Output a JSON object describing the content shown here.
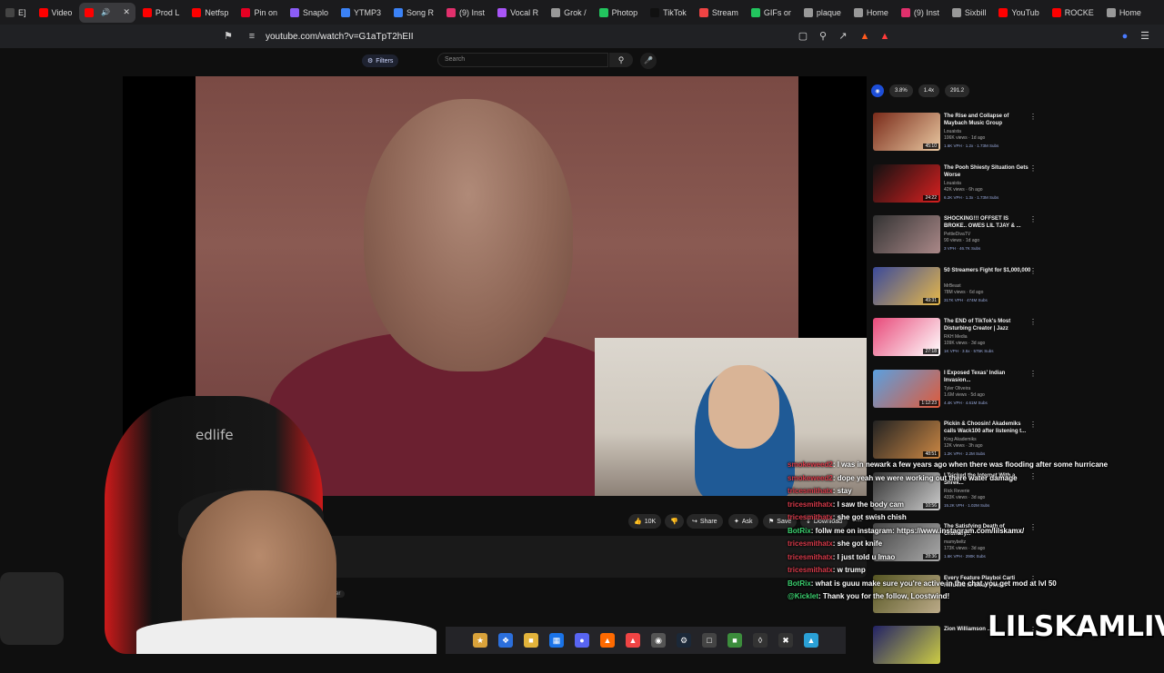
{
  "tabs": [
    {
      "label": "E]",
      "color": "#444"
    },
    {
      "label": "Video",
      "color": "#ff0000"
    },
    {
      "label": "",
      "color": "#ff0000",
      "active": true
    },
    {
      "label": "Prod L",
      "color": "#ff0000"
    },
    {
      "label": "Netfsp",
      "color": "#ff0000"
    },
    {
      "label": "Pin on",
      "color": "#e60023"
    },
    {
      "label": "Snaplo",
      "color": "#8b5cf6"
    },
    {
      "label": "YTMP3",
      "color": "#3b82f6"
    },
    {
      "label": "Song R",
      "color": "#3b82f6"
    },
    {
      "label": "(9) Inst",
      "color": "#e1306c"
    },
    {
      "label": "Vocal R",
      "color": "#a855f7"
    },
    {
      "label": "Grok /",
      "color": "#999"
    },
    {
      "label": "Photop",
      "color": "#22c55e"
    },
    {
      "label": "TikTok",
      "color": "#111"
    },
    {
      "label": "Stream",
      "color": "#ef4444"
    },
    {
      "label": "GIFs or",
      "color": "#22c55e"
    },
    {
      "label": "plaque",
      "color": "#999"
    },
    {
      "label": "Home",
      "color": "#999"
    },
    {
      "label": "(9) Inst",
      "color": "#e1306c"
    },
    {
      "label": "Sixbill",
      "color": "#999"
    },
    {
      "label": "YouTub",
      "color": "#ff0000"
    },
    {
      "label": "ROCKE",
      "color": "#ff0000"
    },
    {
      "label": "Home",
      "color": "#999"
    }
  ],
  "address_bar": {
    "url": "youtube.com/watch?v=G1aTpT2hEII"
  },
  "youtube": {
    "filters_label": "Filters",
    "search_placeholder": "Search",
    "sort_label": "Filter"
  },
  "actions": {
    "like_count": "10K",
    "share_label": "Share",
    "ask_label": "Ask",
    "save_label": "Save",
    "download_label": "Download"
  },
  "sidebar_stats": [
    "3.8%",
    "1.4x",
    "291.2"
  ],
  "recommendations": [
    {
      "title": "The Rise and Collapse of Maybach Music Group",
      "channel": "Louaista",
      "meta": "106K views · 1d ago",
      "badge": "1.6K VPH · 1.2x · 1.73M Subs",
      "duration": "45:10",
      "c1": "#7a2b1a",
      "c2": "#e8c7a0"
    },
    {
      "title": "The Pooh Shiesty Situation Gets Worse",
      "channel": "Louaista",
      "meta": "42K views · 6h ago",
      "badge": "6.2K VPH · 1.3x · 1.73M Subs",
      "duration": "24:22",
      "c1": "#111",
      "c2": "#d92020"
    },
    {
      "title": "SHOCKING!!! OFFSET IS BROKE.. OWES LIL TJAY & ...",
      "channel": "PettieDivaTV",
      "meta": "90 views · 1d ago",
      "badge": "3 VPH · 46.7K Subs",
      "duration": "",
      "c1": "#333",
      "c2": "#a88"
    },
    {
      "title": "50 Streamers Fight for $1,000,000",
      "channel": "MrBeast",
      "meta": "78M views · 6d ago",
      "badge": "317K VPH · 474M Subs",
      "duration": "49:31",
      "c1": "#3b4a9a",
      "c2": "#e6b84a"
    },
    {
      "title": "The END of TikTok's Most Disturbing Creator | Jazz",
      "channel": "RKH Media",
      "meta": "109K views · 3d ago",
      "badge": "1K VPH · 3.5x · 575K Subs",
      "duration": "27:18",
      "c1": "#e84a7a",
      "c2": "#fff"
    },
    {
      "title": "I Exposed Texas' Indian Invasion...",
      "channel": "Tyler Oliveira",
      "meta": "1.6M views · 5d ago",
      "badge": "4.4K VPH · 4.61M Subs",
      "duration": "1:12:23",
      "c1": "#5aa0e0",
      "c2": "#e05a3a"
    },
    {
      "title": "Pickin & Choosin! Akademiks calls Wack100 after listening t...",
      "channel": "King Akademiks",
      "meta": "12K views · 3h ago",
      "badge": "1.2K VPH · 2.2M Subs",
      "duration": "48:51",
      "c1": "#222",
      "c2": "#c84"
    },
    {
      "title": "I Tricked the Internet With a Shrek...",
      "channel": "Rick Reverie",
      "meta": "433K views · 3d ago",
      "badge": "15.2K VPH · 1.02M Subs",
      "duration": "10:56",
      "c1": "#333",
      "c2": "#ccc"
    },
    {
      "title": "The Satisfying Death of Ordinary...",
      "channel": "mamybeltz",
      "meta": "173K views · 3d ago",
      "badge": "1.6K VPH · 290K Subs",
      "duration": "28:36",
      "c1": "#444",
      "c2": "#aaa"
    },
    {
      "title": "Every Feature Playboi Carti Refused to Clear (And...",
      "channel": "",
      "meta": "",
      "badge": "",
      "duration": "",
      "c1": "#552",
      "c2": "#ba8"
    },
    {
      "title": "Zion Williamson ...",
      "channel": "",
      "meta": "",
      "badge": "",
      "duration": "",
      "c1": "#226",
      "c2": "#cc4"
    }
  ],
  "chat": [
    {
      "name": "smokeweed2",
      "msg": ": I was in newark a few years ago when there was flooding after some hurricane",
      "style": ""
    },
    {
      "name": "smokeweed2",
      "msg": ": dope yeah we were working out there water damage",
      "style": ""
    },
    {
      "name": "tricesmithatx",
      "msg": ": stay",
      "style": ""
    },
    {
      "name": "tricesmithatx",
      "msg": ": I saw the body cam",
      "style": ""
    },
    {
      "name": "tricesmithatx",
      "msg": ": she got swish chish",
      "style": ""
    },
    {
      "name": "BotRix",
      "msg": ": follw me on instagram: https://www.instagram.com/lilskamx/",
      "style": "g"
    },
    {
      "name": "tricesmithatx",
      "msg": ": she got knife",
      "style": ""
    },
    {
      "name": "tricesmithatx",
      "msg": ": I just told u lmao",
      "style": ""
    },
    {
      "name": "tricesmithatx",
      "msg": ": w trump",
      "style": ""
    },
    {
      "name": "BotRix",
      "msg": ": what is guuu make sure you're active in the chat you get mod at lvl 50",
      "style": "g"
    },
    {
      "name": "@Kicklet",
      "msg": ": Thank you for the follow, Loostwind!",
      "style": "g"
    }
  ],
  "brand_text": "LILSKAMLIVE",
  "chair_logo": "edlife"
}
